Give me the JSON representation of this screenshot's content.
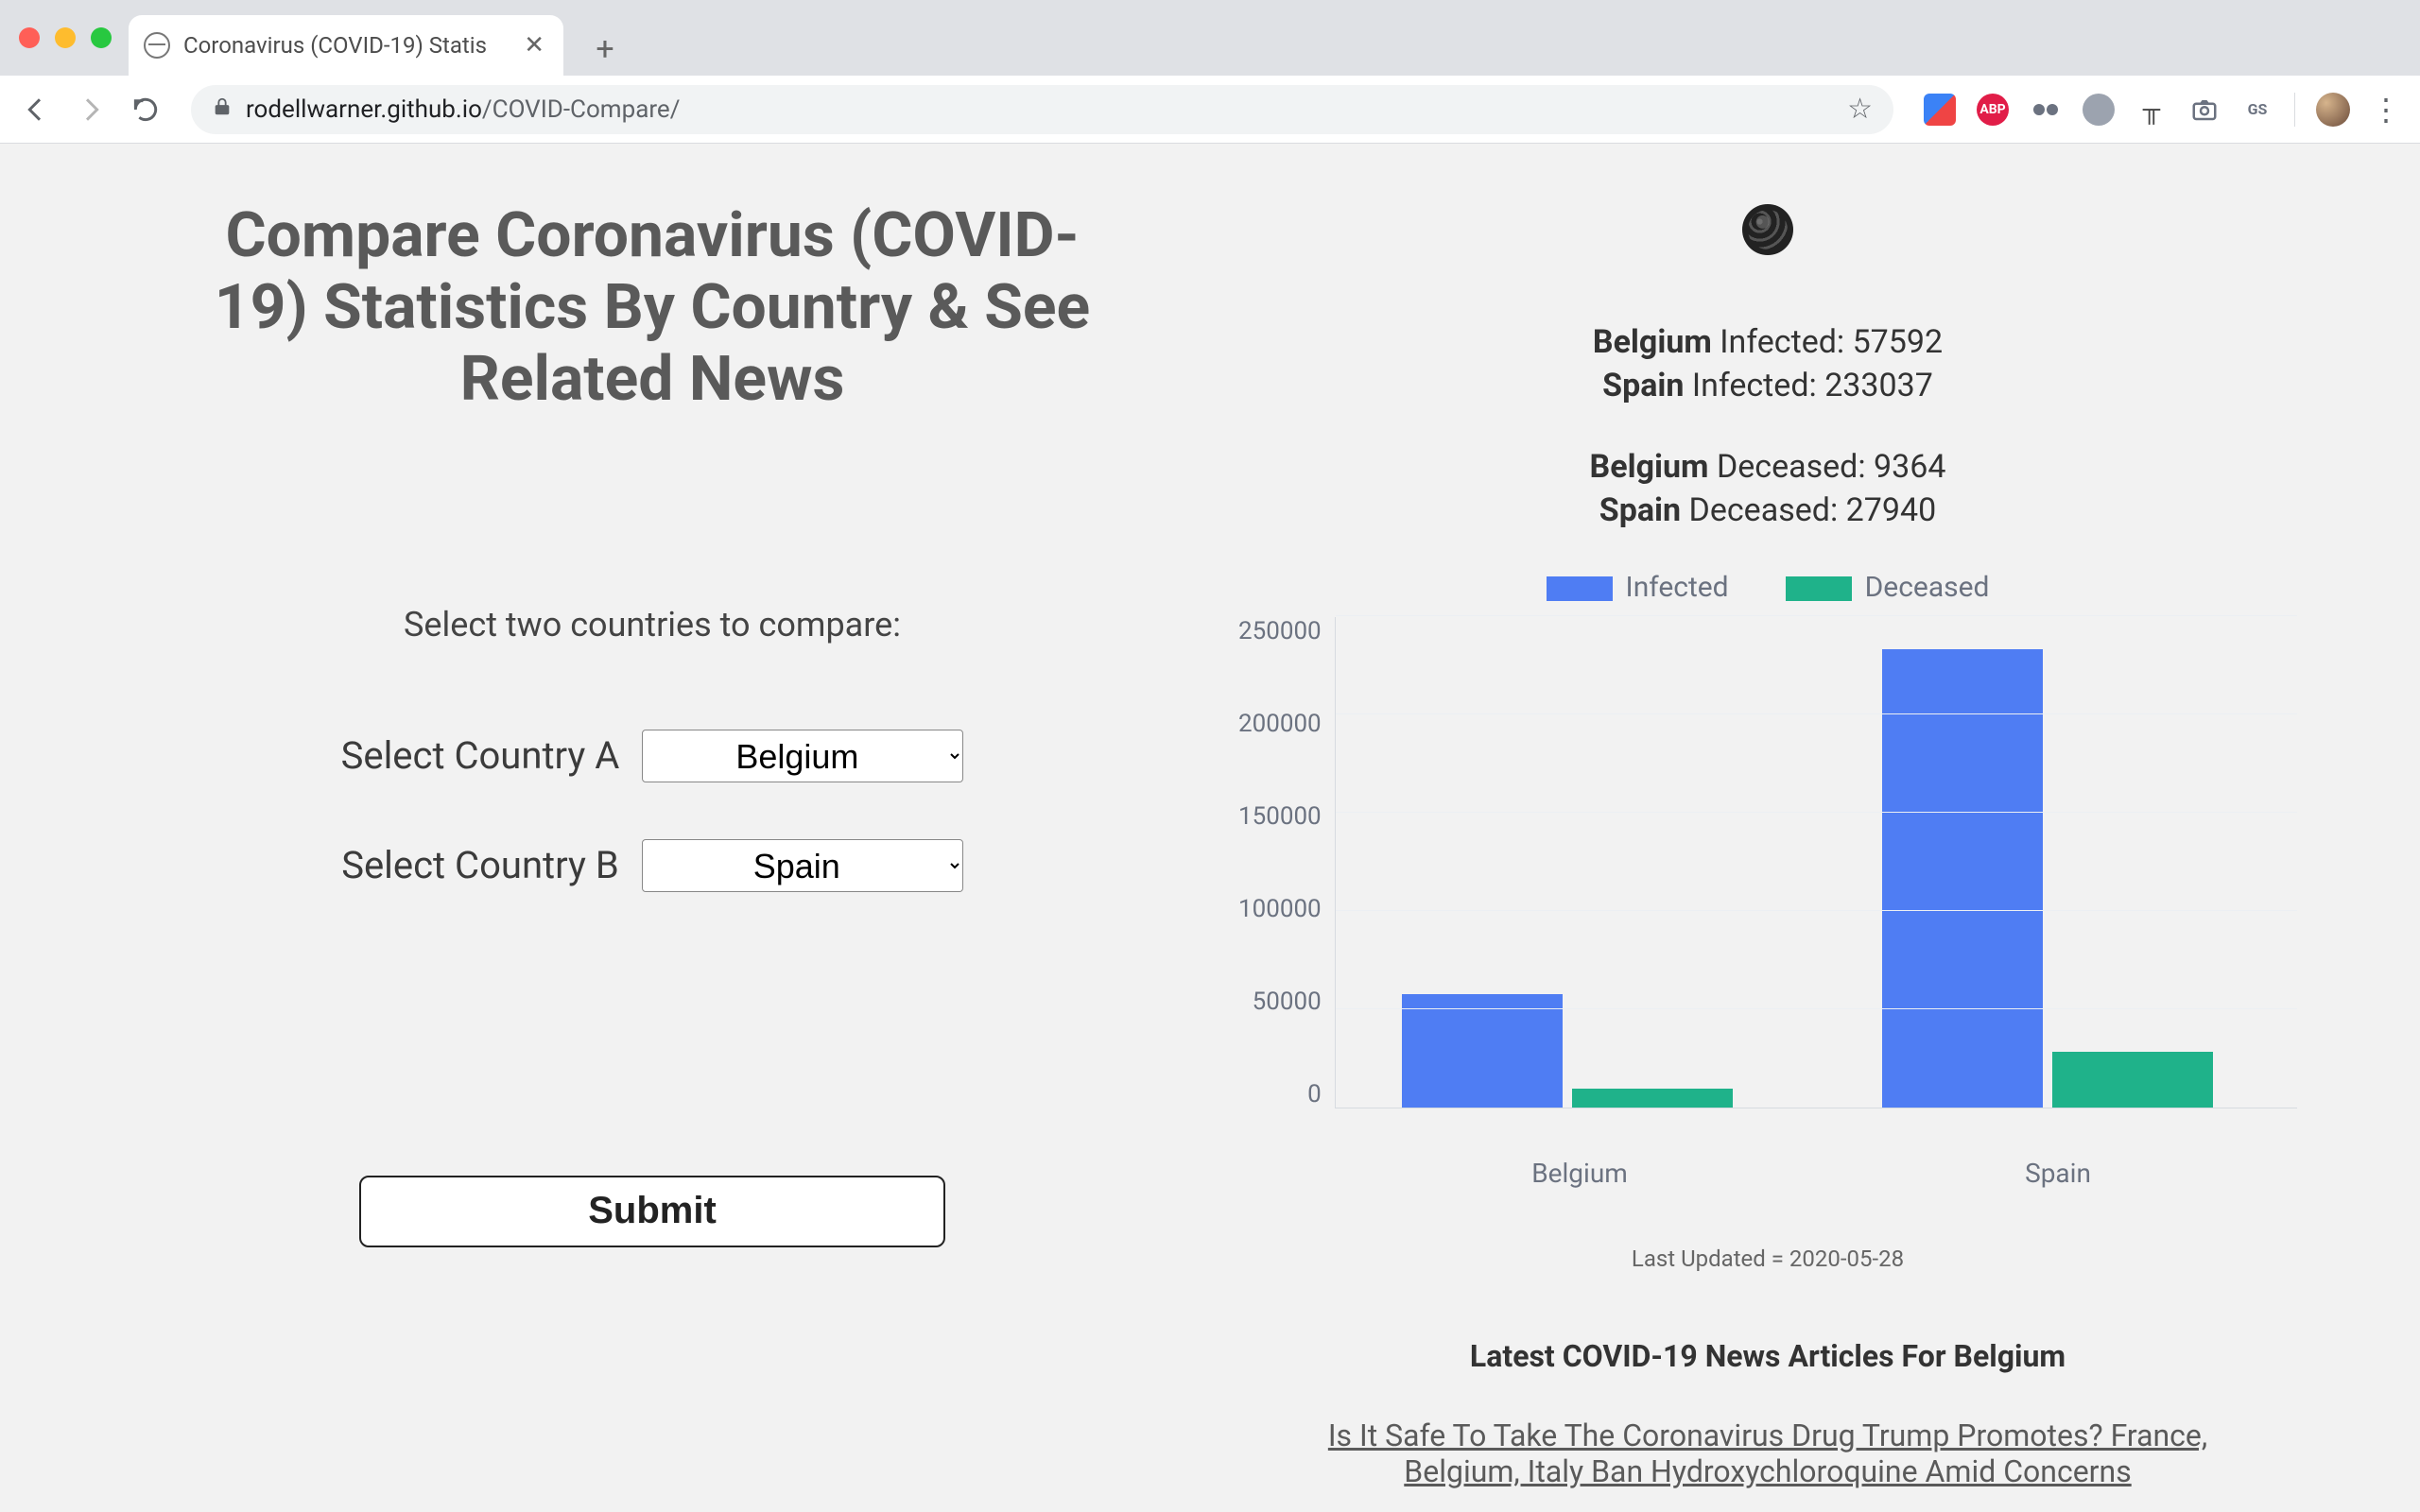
{
  "browser": {
    "tab_title": "Coronavirus (COVID-19) Statis",
    "url_domain": "rodellwarner.github.io",
    "url_path": "/COVID-Compare/"
  },
  "header": {
    "title": "Compare Coronavirus (COVID-19) Statistics By Country & See Related News"
  },
  "form": {
    "prompt": "Select two countries to compare:",
    "label_a": "Select Country A",
    "label_b": "Select Country B",
    "value_a": "Belgium",
    "value_b": "Spain",
    "submit_label": "Submit"
  },
  "stats": {
    "infected": [
      {
        "country": "Belgium",
        "label": "Infected:",
        "value": "57592"
      },
      {
        "country": "Spain",
        "label": "Infected:",
        "value": "233037"
      }
    ],
    "deceased": [
      {
        "country": "Belgium",
        "label": "Deceased:",
        "value": "9364"
      },
      {
        "country": "Spain",
        "label": "Deceased:",
        "value": "27940"
      }
    ]
  },
  "legend": {
    "series1": "Infected",
    "series2": "Deceased"
  },
  "last_updated": "Last Updated = 2020-05-28",
  "news": {
    "heading": "Latest COVID-19 News Articles For Belgium",
    "article1": "Is It Safe To Take The Coronavirus Drug Trump Promotes? France, Belgium, Italy Ban Hydroxychloroquine Amid Concerns"
  },
  "chart_data": {
    "type": "bar",
    "categories": [
      "Belgium",
      "Spain"
    ],
    "series": [
      {
        "name": "Infected",
        "color": "#4f7df3",
        "values": [
          57592,
          233037
        ]
      },
      {
        "name": "Deceased",
        "color": "#1fb28a",
        "values": [
          9364,
          27940
        ]
      }
    ],
    "ylim": [
      0,
      250000
    ],
    "yticks": [
      0,
      50000,
      100000,
      150000,
      200000,
      250000
    ],
    "title": "",
    "xlabel": "",
    "ylabel": ""
  }
}
